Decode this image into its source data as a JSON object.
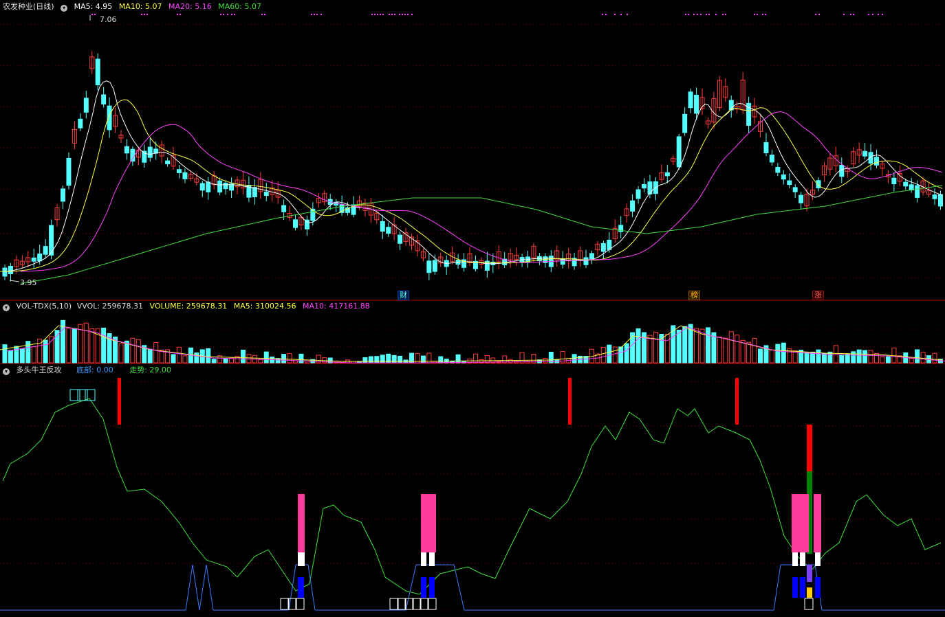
{
  "stock": {
    "name": "农发种业(日线)"
  },
  "main_header": {
    "ma5": "MA5: 4.95",
    "ma10": "MA10: 5.07",
    "ma20": "MA20: 5.16",
    "ma60": "MA60: 5.07"
  },
  "price_labels": {
    "high": "7.06",
    "low": "3.95"
  },
  "event_markers": {
    "cai": "财",
    "bang": "榜",
    "zhang": "涨"
  },
  "vol_header": {
    "name": "VOL-TDX(5,10)",
    "vvol": "VVOL: 259678.31",
    "volume": "VOLUME: 259678.31",
    "ma5": "MA5: 310024.56",
    "ma10": "MA10: 417161.88"
  },
  "ind_header": {
    "name": "多头牛王反攻",
    "bottom": "底部: 0.00",
    "trend": "走势: 29.00"
  },
  "colors": {
    "up": "#ff3c3c",
    "down": "#54ffff",
    "ma5": "#ffffff",
    "ma10": "#ffff40",
    "ma20": "#ff40ff",
    "ma60": "#40e040",
    "grid": "#8a0000",
    "label": "#ffffff",
    "trend": "#40e040",
    "bottom": "#3c78ff",
    "pink": "#ff3c9b"
  }
}
